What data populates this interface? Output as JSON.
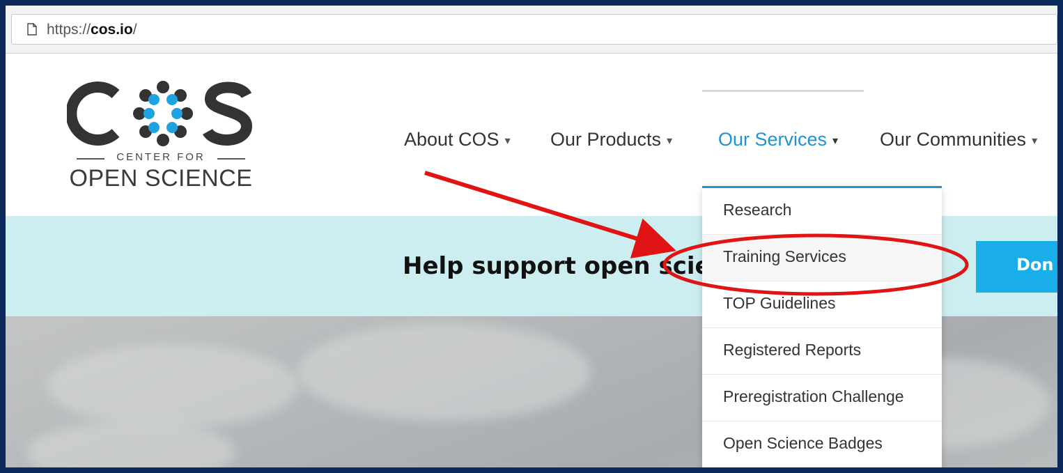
{
  "browser": {
    "url_prefix": "https://",
    "url_host": "cos.io",
    "url_suffix": "/"
  },
  "logo": {
    "letters": "COS",
    "subtitle": "CENTER FOR",
    "title": "OPEN SCIENCE"
  },
  "nav": {
    "items": [
      {
        "label": "About COS",
        "caret": "▾"
      },
      {
        "label": "Our Products",
        "caret": "▾"
      },
      {
        "label": "Our Services",
        "caret": "▾"
      },
      {
        "label": "Our Communities",
        "caret": "▾"
      }
    ]
  },
  "banner": {
    "text": "Help support open scie",
    "donate_label": "Don"
  },
  "dropdown": {
    "items": [
      "Research",
      "Training Services",
      "TOP Guidelines",
      "Registered Reports",
      "Preregistration Challenge",
      "Open Science Badges"
    ]
  },
  "colors": {
    "accent": "#1f93d1",
    "banner_bg": "#cdeef0",
    "donate_bg": "#1aaee8",
    "annotation": "#e01414",
    "frame": "#0b2a5b"
  },
  "icons": {
    "page": "page-icon",
    "caret": "caret-down-icon"
  }
}
